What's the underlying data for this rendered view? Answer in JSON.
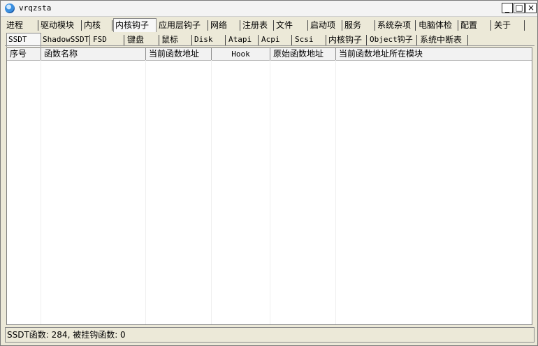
{
  "window": {
    "title": "vrqzsta",
    "min_label": "_",
    "max_label": "□",
    "close_label": "×"
  },
  "main_tabs": [
    {
      "label": "进程"
    },
    {
      "label": "驱动模块"
    },
    {
      "label": "内核"
    },
    {
      "label": "内核钩子"
    },
    {
      "label": "应用层钩子"
    },
    {
      "label": "网络"
    },
    {
      "label": "注册表"
    },
    {
      "label": "文件"
    },
    {
      "label": "启动项"
    },
    {
      "label": "服务"
    },
    {
      "label": "系统杂项"
    },
    {
      "label": "电脑体检"
    },
    {
      "label": "配置"
    },
    {
      "label": "关于"
    }
  ],
  "active_main_tab": "内核钩子",
  "sub_tabs": [
    {
      "label": "SSDT"
    },
    {
      "label": "ShadowSSDT"
    },
    {
      "label": "FSD"
    },
    {
      "label": "键盘"
    },
    {
      "label": "鼠标"
    },
    {
      "label": "Disk"
    },
    {
      "label": "Atapi"
    },
    {
      "label": "Acpi"
    },
    {
      "label": "Scsi"
    },
    {
      "label": "内核钩子"
    },
    {
      "label": "Object钩子"
    },
    {
      "label": "系统中断表"
    }
  ],
  "active_sub_tab": "SSDT",
  "columns": [
    {
      "label": "序号"
    },
    {
      "label": "函数名称"
    },
    {
      "label": "当前函数地址"
    },
    {
      "label": "Hook"
    },
    {
      "label": "原始函数地址"
    },
    {
      "label": "当前函数地址所在模块"
    }
  ],
  "status": {
    "text": "SSDT函数: 284, 被挂钩函数: 0"
  }
}
